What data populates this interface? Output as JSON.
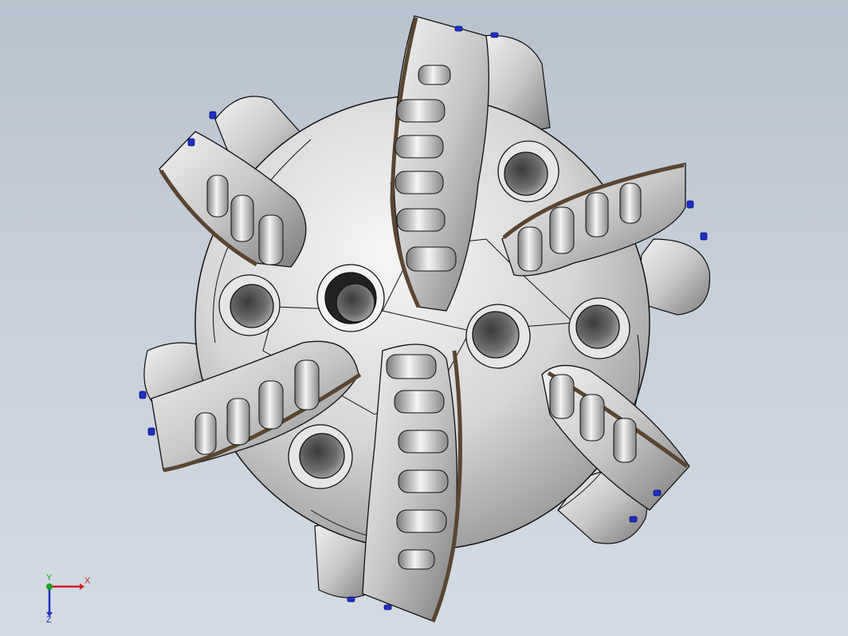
{
  "triad": {
    "x_label": "X",
    "y_label": "Y",
    "z_label": "Z"
  },
  "colors": {
    "background_top": "#b8c2cf",
    "background_bottom": "#d3dbe4",
    "x_axis": "#d02020",
    "y_axis": "#20a020",
    "z_axis": "#2030c0",
    "body": "#dcdcdc",
    "edge": "#111111",
    "gauge_pad": "#5a4530",
    "nozzle_marker": "#1c2fc8"
  },
  "model": {
    "blade_count": 6,
    "nozzle_count": 6,
    "cutters_per_blade": 6
  }
}
